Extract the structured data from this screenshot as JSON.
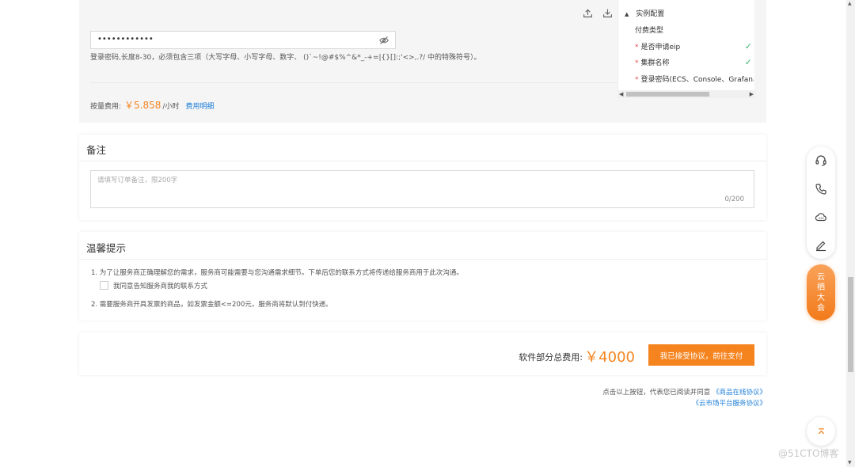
{
  "top": {
    "password_dots": "••••••••••••",
    "password_hint": "登录密码,长度8-30，必须包含三项（大写字母、小写字母、数字、 ()`~!@#$%^&*_-+=|{}[]:;'<>,.?/ 中的特殊符号）。",
    "fee_label": "按量费用:",
    "fee_price": "￥5.858",
    "fee_unit": "/小时",
    "fee_link": "费用明细"
  },
  "config": {
    "title": "实例配置",
    "rows": [
      {
        "label": "付费类型",
        "required": false,
        "checked": false
      },
      {
        "label": "是否申请eip",
        "required": true,
        "checked": true
      },
      {
        "label": "集群名称",
        "required": true,
        "checked": true
      },
      {
        "label": "登录密码(ECS、Console、Grafana、",
        "required": true,
        "checked": false
      }
    ],
    "check_mark": "✓",
    "star": "*"
  },
  "remark": {
    "title": "备注",
    "placeholder": "请填写订单备注，限200字",
    "count": "0/200"
  },
  "tips": {
    "title": "温馨提示",
    "line1": "1. 为了让服务商正确理解您的需求，服务商可能需要与您沟通需求细节。下单后您的联系方式将传递给服务商用于此次沟通。",
    "checkbox_label": "我同意告知服务商我的联系方式",
    "line2": "2. 需要服务商开具发票的商品，如发票金额<=200元，服务商将默认到付快递。"
  },
  "total": {
    "label": "软件部分总费用:",
    "amount": "￥4000",
    "pay_button": "我已接受协议，前往支付"
  },
  "agreement": {
    "prefix": "点击以上按钮，代表您已阅读并同意",
    "link1": "《商品在线协议》",
    "link2": "《云市场平台服务协议》"
  },
  "float": {
    "yunqi_chars": [
      "云",
      "栖",
      "大",
      "会"
    ],
    "to_top": "⌃"
  },
  "watermark": "@51CTO博客",
  "colors": {
    "accent": "#f5841f",
    "link": "#1e7fd8",
    "required": "#e84e4e",
    "check": "#3cb371"
  }
}
